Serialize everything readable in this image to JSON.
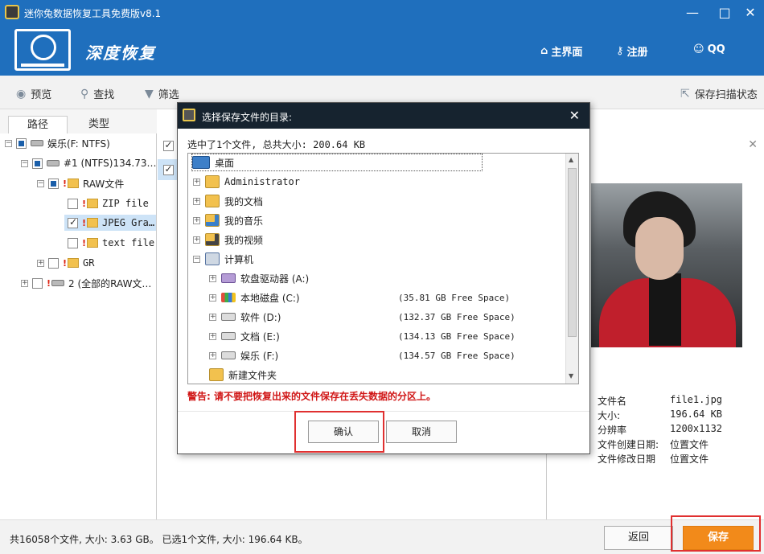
{
  "window": {
    "title": "迷你兔数据恢复工具免费版v8.1"
  },
  "header": {
    "brand": "深度恢复",
    "nav": {
      "home": "主界面",
      "register": "注册",
      "qq": "QQ"
    }
  },
  "toolbar": {
    "preview": "预览",
    "search": "查找",
    "filter": "筛选",
    "save_scan": "保存扫描状态"
  },
  "tabs": {
    "path": "路径",
    "type": "类型"
  },
  "tree": {
    "items": [
      {
        "label": "娱乐(F: NTFS)"
      },
      {
        "label": "#1 (NTFS)134.73…"
      },
      {
        "label": "RAW文件"
      },
      {
        "label": "ZIP file"
      },
      {
        "label": "JPEG Gra…"
      },
      {
        "label": "text file"
      },
      {
        "label": "GR"
      },
      {
        "label": "2 (全部的RAW文…"
      }
    ]
  },
  "preview": {
    "info": [
      {
        "key": "文件名",
        "value": "file1.jpg"
      },
      {
        "key": "大小:",
        "value": "196.64 KB"
      },
      {
        "key": "分辨率",
        "value": "1200x1132"
      },
      {
        "key": "文件创建日期:",
        "value": "位置文件"
      },
      {
        "key": "文件修改日期",
        "value": "位置文件"
      }
    ]
  },
  "status": {
    "summary": "共16058个文件, 大小: 3.63 GB。 已选1个文件, 大小: 196.64 KB。",
    "back": "返回",
    "save": "保存"
  },
  "dialog": {
    "title": "选择保存文件的目录:",
    "summary": "选中了1个文件, 总共大小: 200.64 KB",
    "tree": [
      {
        "label": "桌面"
      },
      {
        "label": "Administrator"
      },
      {
        "label": "我的文档"
      },
      {
        "label": "我的音乐"
      },
      {
        "label": "我的视频"
      },
      {
        "label": "计算机"
      },
      {
        "label": "软盘驱动器 (A:)",
        "free": ""
      },
      {
        "label": "本地磁盘 (C:)",
        "free": "(35.81 GB Free Space)"
      },
      {
        "label": "软件 (D:)",
        "free": "(132.37 GB Free Space)"
      },
      {
        "label": "文档 (E:)",
        "free": "(134.13 GB Free Space)"
      },
      {
        "label": "娱乐 (F:)",
        "free": "(134.57 GB Free Space)"
      },
      {
        "label": "新建文件夹"
      }
    ],
    "warning": "警告: 请不要把恢复出来的文件保存在丢失数据的分区上。",
    "confirm": "确认",
    "cancel": "取消"
  },
  "colors": {
    "header_blue": "#1f6fbd",
    "save_orange": "#f28a1a",
    "warning_red": "#d01616",
    "highlight_red": "#e03030"
  }
}
